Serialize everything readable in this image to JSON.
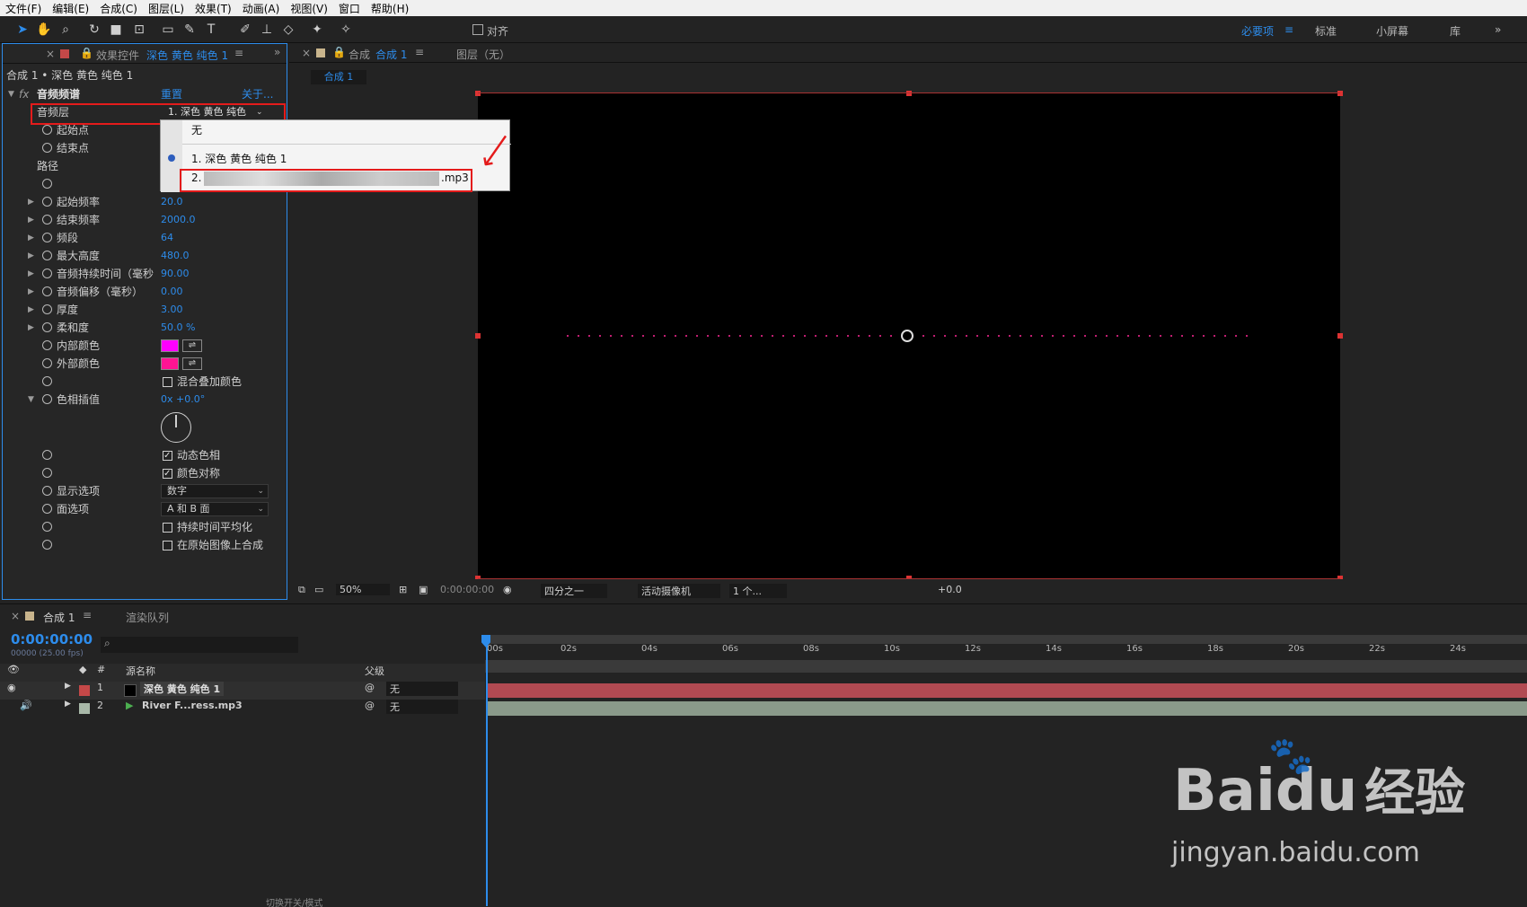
{
  "menu": [
    "文件(F)",
    "编辑(E)",
    "合成(C)",
    "图层(L)",
    "效果(T)",
    "动画(A)",
    "视图(V)",
    "窗口",
    "帮助(H)"
  ],
  "toolbar": {
    "align_label": "对齐",
    "workspaces": [
      "必要项",
      "标准",
      "小屏幕",
      "库"
    ]
  },
  "effect_panel": {
    "tab_prefix": "效果控件",
    "tab_layer": "深色 黄色 纯色 1",
    "breadcrumb": "合成 1 • 深色 黄色 纯色 1",
    "effect_name": "音频频谱",
    "reset": "重置",
    "about": "关于...",
    "audio_layer_label": "音频层",
    "audio_layer_value": "1. 深色 黄色 纯色",
    "params": [
      {
        "label": "起始点",
        "value": ""
      },
      {
        "label": "结束点",
        "value": ""
      },
      {
        "label": "路径",
        "value": ""
      },
      {
        "label": "",
        "value": ""
      },
      {
        "label": "起始频率",
        "value": "20.0"
      },
      {
        "label": "结束频率",
        "value": "2000.0"
      },
      {
        "label": "频段",
        "value": "64"
      },
      {
        "label": "最大高度",
        "value": "480.0"
      },
      {
        "label": "音频持续时间（毫秒",
        "value": "90.00"
      },
      {
        "label": "音频偏移（毫秒）",
        "value": "0.00"
      },
      {
        "label": "厚度",
        "value": "3.00"
      },
      {
        "label": "柔和度",
        "value": "50.0 %"
      },
      {
        "label": "内部颜色",
        "value": ""
      },
      {
        "label": "外部颜色",
        "value": ""
      }
    ],
    "blend_overlap": "混合叠加颜色",
    "hue_interp_label": "色相插值",
    "hue_interp_value": "0x +0.0°",
    "dynamic_hue": "动态色相",
    "color_symmetry": "颜色对称",
    "display_options_label": "显示选项",
    "display_options_value": "数字",
    "side_options_label": "面选项",
    "side_options_value": "A 和 B 面",
    "duration_avg": "持续时间平均化",
    "composite_on_original": "在原始图像上合成",
    "inside_color": "#ff00ff",
    "outside_color": "#ff1493"
  },
  "popup": {
    "items": [
      "无",
      "1. 深色 黄色 纯色 1",
      "2.",
      ".mp3"
    ]
  },
  "viewer": {
    "tab_label": "合成",
    "tab_name": "合成 1",
    "layer_label": "图层（无）",
    "sub_tab": "合成 1"
  },
  "viewbar": {
    "zoom": "50%",
    "timecode": "0:00:00:00",
    "resolution": "四分之一",
    "camera": "活动摄像机",
    "views": "1 个...",
    "exposure": "+0.0"
  },
  "timeline": {
    "tab": "合成 1",
    "render_queue": "渲染队列",
    "timecode": "0:00:00:00",
    "fps": "00000 (25.00 fps)",
    "col_num": "#",
    "col_source": "源名称",
    "col_parent": "父级",
    "layers": [
      {
        "num": "1",
        "name": "深色 黄色 纯色 1",
        "parent": "无",
        "color": "#c44848"
      },
      {
        "num": "2",
        "name": "River F...ress.mp3",
        "parent": "无",
        "color": "#a8b8a8"
      }
    ],
    "ruler": [
      "00s",
      "02s",
      "04s",
      "06s",
      "08s",
      "10s",
      "12s",
      "14s",
      "16s",
      "18s",
      "20s",
      "22s",
      "24s"
    ],
    "bottom_label": "切换开关/模式"
  },
  "watermark": {
    "brand": "Baidu",
    "cn": "经验",
    "url": "jingyan.baidu.com"
  }
}
